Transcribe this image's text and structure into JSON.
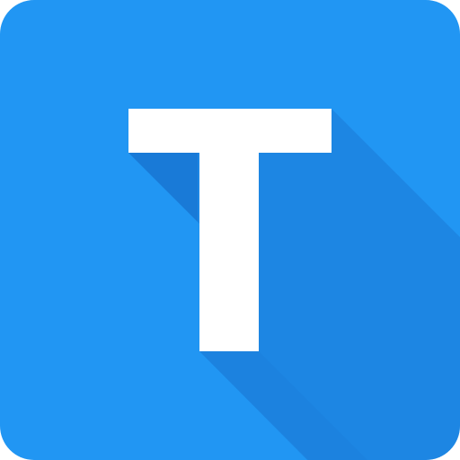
{
  "icon": {
    "name": "letter-t-app-icon",
    "letter": "T",
    "colors": {
      "background": "#2196F3",
      "letter": "#FFFFFF",
      "shadow": "#1565C0"
    }
  }
}
